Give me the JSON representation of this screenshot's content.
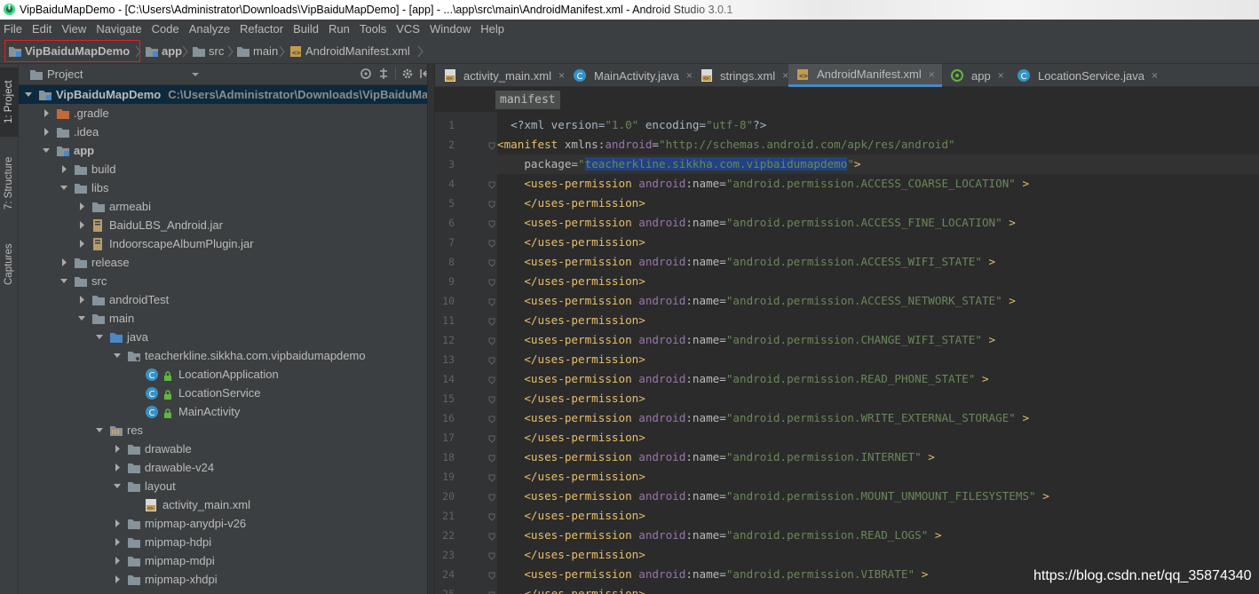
{
  "window": {
    "title": "VipBaiduMapDemo - [C:\\Users\\Administrator\\Downloads\\VipBaiduMapDemo] - [app] - ...\\app\\src\\main\\AndroidManifest.xml - Android Studio 3.0.1"
  },
  "menu": [
    "File",
    "Edit",
    "View",
    "Navigate",
    "Code",
    "Analyze",
    "Refactor",
    "Build",
    "Run",
    "Tools",
    "VCS",
    "Window",
    "Help"
  ],
  "nav": {
    "project": "VipBaiduMapDemo",
    "module": "app",
    "src": "src",
    "main": "main",
    "file": "AndroidManifest.xml"
  },
  "toolstrip": {
    "project_tab": "1: Project",
    "structure_tab": "7: Structure",
    "captures_tab": "Captures"
  },
  "project_panel": {
    "title": "Project",
    "tree": [
      {
        "label": "VipBaiduMapDemo",
        "path": "C:\\Users\\Administrator\\Downloads\\VipBaiduMapDemo",
        "icon": "module-folder-icon",
        "expanded": true
      },
      {
        "label": ".gradle",
        "icon": "folder-orange-icon",
        "expanded": false
      },
      {
        "label": ".idea",
        "icon": "folder-icon",
        "expanded": false
      },
      {
        "label": "app",
        "icon": "module-folder-icon",
        "expanded": true
      },
      {
        "label": "build",
        "icon": "folder-icon",
        "expanded": false
      },
      {
        "label": "libs",
        "icon": "folder-icon",
        "expanded": true
      },
      {
        "label": "armeabi",
        "icon": "folder-icon",
        "expanded": false
      },
      {
        "label": "BaiduLBS_Android.jar",
        "icon": "jar-icon",
        "expanded": false
      },
      {
        "label": "IndoorscapeAlbumPlugin.jar",
        "icon": "jar-icon",
        "expanded": false
      },
      {
        "label": "release",
        "icon": "folder-icon",
        "expanded": false
      },
      {
        "label": "src",
        "icon": "folder-icon",
        "expanded": true
      },
      {
        "label": "androidTest",
        "icon": "folder-icon",
        "expanded": false
      },
      {
        "label": "main",
        "icon": "folder-icon",
        "expanded": true
      },
      {
        "label": "java",
        "icon": "folder-blue-icon",
        "expanded": true
      },
      {
        "label": "teacherkline.sikkha.com.vipbaidumapdemo",
        "icon": "package-icon",
        "expanded": true
      },
      {
        "label": "LocationApplication",
        "icon": "class-icon"
      },
      {
        "label": "LocationService",
        "icon": "class-icon"
      },
      {
        "label": "MainActivity",
        "icon": "class-icon"
      },
      {
        "label": "res",
        "icon": "res-folder-icon",
        "expanded": true
      },
      {
        "label": "drawable",
        "icon": "folder-icon",
        "expanded": false
      },
      {
        "label": "drawable-v24",
        "icon": "folder-icon",
        "expanded": false
      },
      {
        "label": "layout",
        "icon": "folder-icon",
        "expanded": true
      },
      {
        "label": "activity_main.xml",
        "icon": "xml-file-icon"
      },
      {
        "label": "mipmap-anydpi-v26",
        "icon": "folder-icon",
        "expanded": false
      },
      {
        "label": "mipmap-hdpi",
        "icon": "folder-icon",
        "expanded": false
      },
      {
        "label": "mipmap-mdpi",
        "icon": "folder-icon",
        "expanded": false
      },
      {
        "label": "mipmap-xhdpi",
        "icon": "folder-icon",
        "expanded": false
      }
    ]
  },
  "tabs": [
    {
      "label": "activity_main.xml",
      "icon": "xml-file-icon",
      "active": false
    },
    {
      "label": "MainActivity.java",
      "icon": "class-icon",
      "active": false
    },
    {
      "label": "strings.xml",
      "icon": "xml-file-icon",
      "active": false
    },
    {
      "label": "AndroidManifest.xml",
      "icon": "manifest-icon",
      "active": true
    },
    {
      "label": "app",
      "icon": "gradle-icon",
      "active": false
    },
    {
      "label": "LocationService.java",
      "icon": "class-icon",
      "active": false
    }
  ],
  "editor": {
    "breadcrumb": "manifest",
    "lines": [
      {
        "n": "1",
        "text": "<?xml version=\"1.0\" encoding=\"utf-8\"?>"
      },
      {
        "n": "2",
        "text": "<manifest xmlns:android=\"http://schemas.android.com/apk/res/android\""
      },
      {
        "n": "3",
        "text": "package=\"teacherkline.sikkha.com.vipbaidumapdemo\">"
      },
      {
        "n": "4",
        "perm": "android.permission.ACCESS_COARSE_LOCATION"
      },
      {
        "n": "5",
        "close": "</uses-permission>"
      },
      {
        "n": "6",
        "perm": "android.permission.ACCESS_FINE_LOCATION"
      },
      {
        "n": "7",
        "close": "</uses-permission>"
      },
      {
        "n": "8",
        "perm": "android.permission.ACCESS_WIFI_STATE"
      },
      {
        "n": "9",
        "close": "</uses-permission>"
      },
      {
        "n": "10",
        "perm": "android.permission.ACCESS_NETWORK_STATE"
      },
      {
        "n": "11",
        "close": "</uses-permission>"
      },
      {
        "n": "12",
        "perm": "android.permission.CHANGE_WIFI_STATE"
      },
      {
        "n": "13",
        "close": "</uses-permission>"
      },
      {
        "n": "14",
        "perm": "android.permission.READ_PHONE_STATE"
      },
      {
        "n": "15",
        "close": "</uses-permission>"
      },
      {
        "n": "16",
        "perm": "android.permission.WRITE_EXTERNAL_STORAGE"
      },
      {
        "n": "17",
        "close": "</uses-permission>"
      },
      {
        "n": "18",
        "perm": "android.permission.INTERNET"
      },
      {
        "n": "19",
        "close": "</uses-permission>"
      },
      {
        "n": "20",
        "perm": "android.permission.MOUNT_UNMOUNT_FILESYSTEMS"
      },
      {
        "n": "21",
        "close": "</uses-permission>"
      },
      {
        "n": "22",
        "perm": "android.permission.READ_LOGS"
      },
      {
        "n": "23",
        "close": "</uses-permission>"
      },
      {
        "n": "24",
        "perm": "android.permission.VIBRATE"
      },
      {
        "n": "25",
        "close": "</uses-permission>"
      }
    ]
  },
  "watermark": "https://blog.csdn.net/qq_35874340",
  "colors": {
    "tag": "#e8bf6a",
    "namespace": "#9876aa",
    "value": "#6a8759",
    "highlight_border": "#e0201e",
    "selection": "#214283"
  }
}
